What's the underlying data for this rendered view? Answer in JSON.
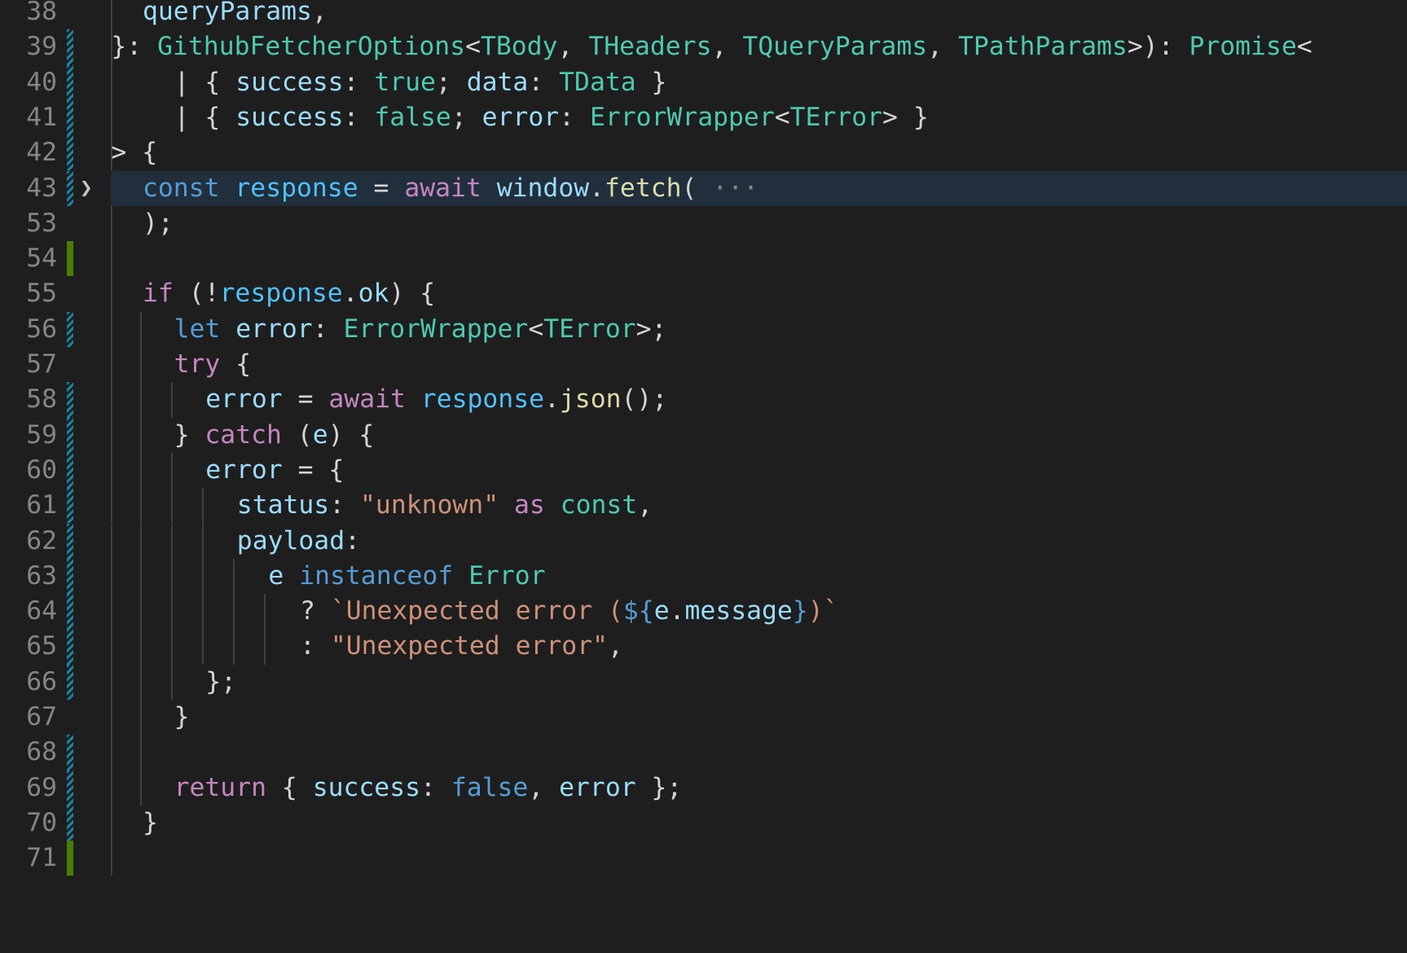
{
  "editor": {
    "colors": {
      "background": "#1e1e1e",
      "line_number": "#858585",
      "keyword": "#c586c0",
      "storage": "#569cd6",
      "variable": "#9cdcfe",
      "type": "#4ec9b0",
      "function": "#dcdcaa",
      "string": "#ce9178",
      "modified_gutter": "#1b81a8",
      "added_gutter": "#487e02"
    },
    "lines": [
      {
        "num": "38",
        "tokens": [
          {
            "t": "queryParams",
            "c": "var"
          },
          {
            "t": ",",
            "c": "pun"
          }
        ]
      },
      {
        "num": "39",
        "tokens": [
          {
            "t": "}",
            "c": "pun"
          },
          {
            "t": ": ",
            "c": "pun"
          },
          {
            "t": "GithubFetcherOptions",
            "c": "typ"
          },
          {
            "t": "<",
            "c": "pun"
          },
          {
            "t": "TBody",
            "c": "typ"
          },
          {
            "t": ", ",
            "c": "pun"
          },
          {
            "t": "THeaders",
            "c": "typ"
          },
          {
            "t": ", ",
            "c": "pun"
          },
          {
            "t": "TQueryParams",
            "c": "typ"
          },
          {
            "t": ", ",
            "c": "pun"
          },
          {
            "t": "TPathParams",
            "c": "typ"
          },
          {
            "t": ">): ",
            "c": "pun"
          },
          {
            "t": "Promise",
            "c": "typ"
          },
          {
            "t": "<",
            "c": "pun"
          }
        ]
      },
      {
        "num": "40",
        "tokens": [
          {
            "t": "| { ",
            "c": "pun"
          },
          {
            "t": "success",
            "c": "var"
          },
          {
            "t": ": ",
            "c": "pun"
          },
          {
            "t": "true",
            "c": "typ"
          },
          {
            "t": "; ",
            "c": "pun"
          },
          {
            "t": "data",
            "c": "var"
          },
          {
            "t": ": ",
            "c": "pun"
          },
          {
            "t": "TData",
            "c": "typ"
          },
          {
            "t": " }",
            "c": "pun"
          }
        ]
      },
      {
        "num": "41",
        "tokens": [
          {
            "t": "| { ",
            "c": "pun"
          },
          {
            "t": "success",
            "c": "var"
          },
          {
            "t": ": ",
            "c": "pun"
          },
          {
            "t": "false",
            "c": "typ"
          },
          {
            "t": "; ",
            "c": "pun"
          },
          {
            "t": "error",
            "c": "var"
          },
          {
            "t": ": ",
            "c": "pun"
          },
          {
            "t": "ErrorWrapper",
            "c": "typ"
          },
          {
            "t": "<",
            "c": "pun"
          },
          {
            "t": "TError",
            "c": "typ"
          },
          {
            "t": "> }",
            "c": "pun"
          }
        ]
      },
      {
        "num": "42",
        "tokens": [
          {
            "t": "> {",
            "c": "pun"
          }
        ]
      },
      {
        "num": "43",
        "tokens": [
          {
            "t": "const",
            "c": "sto"
          },
          {
            "t": " ",
            "c": "pun"
          },
          {
            "t": "response",
            "c": "cst"
          },
          {
            "t": " = ",
            "c": "pun"
          },
          {
            "t": "await",
            "c": "kw"
          },
          {
            "t": " ",
            "c": "pun"
          },
          {
            "t": "window",
            "c": "var"
          },
          {
            "t": ".",
            "c": "pun"
          },
          {
            "t": "fetch",
            "c": "fn"
          },
          {
            "t": "(",
            "c": "pun"
          },
          {
            "t": " ···",
            "c": "ell"
          }
        ]
      },
      {
        "num": "53",
        "tokens": [
          {
            "t": ");",
            "c": "pun"
          }
        ]
      },
      {
        "num": "54",
        "tokens": []
      },
      {
        "num": "55",
        "tokens": [
          {
            "t": "if",
            "c": "kw"
          },
          {
            "t": " (!",
            "c": "pun"
          },
          {
            "t": "response",
            "c": "cst"
          },
          {
            "t": ".",
            "c": "pun"
          },
          {
            "t": "ok",
            "c": "var"
          },
          {
            "t": ") {",
            "c": "pun"
          }
        ]
      },
      {
        "num": "56",
        "tokens": [
          {
            "t": "let",
            "c": "sto"
          },
          {
            "t": " ",
            "c": "pun"
          },
          {
            "t": "error",
            "c": "var"
          },
          {
            "t": ": ",
            "c": "pun"
          },
          {
            "t": "ErrorWrapper",
            "c": "typ"
          },
          {
            "t": "<",
            "c": "pun"
          },
          {
            "t": "TError",
            "c": "typ"
          },
          {
            "t": ">;",
            "c": "pun"
          }
        ]
      },
      {
        "num": "57",
        "tokens": [
          {
            "t": "try",
            "c": "kw"
          },
          {
            "t": " {",
            "c": "pun"
          }
        ]
      },
      {
        "num": "58",
        "tokens": [
          {
            "t": "error",
            "c": "var"
          },
          {
            "t": " = ",
            "c": "pun"
          },
          {
            "t": "await",
            "c": "kw"
          },
          {
            "t": " ",
            "c": "pun"
          },
          {
            "t": "response",
            "c": "cst"
          },
          {
            "t": ".",
            "c": "pun"
          },
          {
            "t": "json",
            "c": "fn"
          },
          {
            "t": "();",
            "c": "pun"
          }
        ]
      },
      {
        "num": "59",
        "tokens": [
          {
            "t": "} ",
            "c": "pun"
          },
          {
            "t": "catch",
            "c": "kw"
          },
          {
            "t": " (",
            "c": "pun"
          },
          {
            "t": "e",
            "c": "var"
          },
          {
            "t": ") {",
            "c": "pun"
          }
        ]
      },
      {
        "num": "60",
        "tokens": [
          {
            "t": "error",
            "c": "var"
          },
          {
            "t": " = {",
            "c": "pun"
          }
        ]
      },
      {
        "num": "61",
        "tokens": [
          {
            "t": "status",
            "c": "var"
          },
          {
            "t": ": ",
            "c": "pun"
          },
          {
            "t": "\"unknown\"",
            "c": "str"
          },
          {
            "t": " ",
            "c": "pun"
          },
          {
            "t": "as",
            "c": "kw"
          },
          {
            "t": " ",
            "c": "pun"
          },
          {
            "t": "const",
            "c": "typ"
          },
          {
            "t": ",",
            "c": "pun"
          }
        ]
      },
      {
        "num": "62",
        "tokens": [
          {
            "t": "payload",
            "c": "var"
          },
          {
            "t": ":",
            "c": "pun"
          }
        ]
      },
      {
        "num": "63",
        "tokens": [
          {
            "t": "e",
            "c": "var"
          },
          {
            "t": " ",
            "c": "pun"
          },
          {
            "t": "instanceof",
            "c": "sto"
          },
          {
            "t": " ",
            "c": "pun"
          },
          {
            "t": "Error",
            "c": "typ"
          }
        ]
      },
      {
        "num": "64",
        "tokens": [
          {
            "t": "? ",
            "c": "pun"
          },
          {
            "t": "`Unexpected error (",
            "c": "str"
          },
          {
            "t": "${",
            "c": "sto"
          },
          {
            "t": "e",
            "c": "var"
          },
          {
            "t": ".",
            "c": "pun"
          },
          {
            "t": "message",
            "c": "var"
          },
          {
            "t": "}",
            "c": "sto"
          },
          {
            "t": ")`",
            "c": "str"
          }
        ]
      },
      {
        "num": "65",
        "tokens": [
          {
            "t": ": ",
            "c": "pun"
          },
          {
            "t": "\"Unexpected error\"",
            "c": "str"
          },
          {
            "t": ",",
            "c": "pun"
          }
        ]
      },
      {
        "num": "66",
        "tokens": [
          {
            "t": "};",
            "c": "pun"
          }
        ]
      },
      {
        "num": "67",
        "tokens": [
          {
            "t": "}",
            "c": "pun"
          }
        ]
      },
      {
        "num": "68",
        "tokens": []
      },
      {
        "num": "69",
        "tokens": [
          {
            "t": "return",
            "c": "kw"
          },
          {
            "t": " { ",
            "c": "pun"
          },
          {
            "t": "success",
            "c": "var"
          },
          {
            "t": ": ",
            "c": "pun"
          },
          {
            "t": "false",
            "c": "lit"
          },
          {
            "t": ", ",
            "c": "pun"
          },
          {
            "t": "error",
            "c": "var"
          },
          {
            "t": " };",
            "c": "pun"
          }
        ]
      },
      {
        "num": "70",
        "tokens": [
          {
            "t": "}",
            "c": "pun"
          }
        ]
      },
      {
        "num": "71",
        "tokens": []
      }
    ]
  }
}
